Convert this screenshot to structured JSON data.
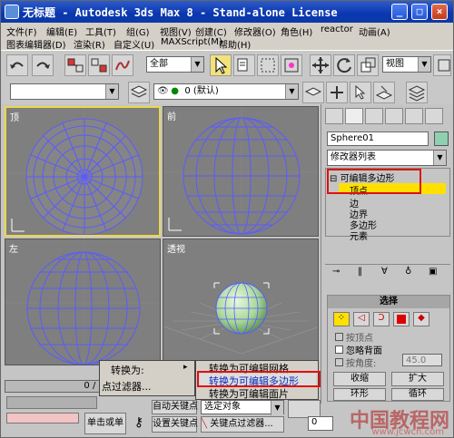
{
  "window": {
    "title": "无标题 - Autodesk 3ds Max 8 - Stand-alone License",
    "buttons": [
      "_",
      "□",
      "×"
    ]
  },
  "menubar": {
    "row1": [
      "文件(F)",
      "编辑(E)",
      "工具(T)",
      "组(G)",
      "视图(V)",
      "创建(C)",
      "修改器(O)",
      "角色(H)",
      "reactor",
      "动画(A)"
    ],
    "row2": [
      "图表编辑器(D)",
      "渲染(R)",
      "自定义(U)",
      "MAXScript(M)",
      "帮助(H)"
    ]
  },
  "toolbar": {
    "selection_filter": "全部",
    "ref_coord": "视图",
    "layer_value": "0 (默认)"
  },
  "viewports": {
    "top": "顶",
    "front": "前",
    "left": "左",
    "perspective": "透视"
  },
  "command_panel": {
    "object_name": "Sphere01",
    "modifier_list": "修改器列表",
    "stack": {
      "root": "可编辑多边形",
      "items": [
        "顶点",
        "边",
        "边界",
        "多边形",
        "元素"
      ],
      "selected": "顶点"
    },
    "selection_rollout": {
      "title": "选择",
      "by_vertex": "按顶点",
      "ignore_backfacing": "忽略背面",
      "by_angle": "按角度:",
      "angle_value": "45.0",
      "shrink": "收缩",
      "grow": "扩大",
      "ring": "环形",
      "loop": "循环"
    }
  },
  "context_menu": {
    "convert_to": "转换为:",
    "items": [
      "转换为可编辑网格",
      "转换为可编辑多边形",
      "转换为可编辑面片"
    ],
    "selected": "转换为可编辑多边形",
    "filter": "点过滤器..."
  },
  "bottom": {
    "frame_counter": "0 / 100",
    "single_click": "单击或单",
    "auto_key": "自动关键点",
    "selected_object": "选定对象",
    "set_key": "设置关键点",
    "key_filters": "关键点过滤器...",
    "frame_number": "0"
  },
  "watermark": {
    "cn": "中国教程网",
    "url": "www.jcwcn.com"
  },
  "colors": {
    "titlebar": "#0a36b0",
    "viewport_bg": "#7f7f7f",
    "wireframe": "#5b5bff",
    "selected_stack": "#ffe000",
    "highlight_box": "#e01010",
    "active_viewport": "#e8d84a"
  }
}
